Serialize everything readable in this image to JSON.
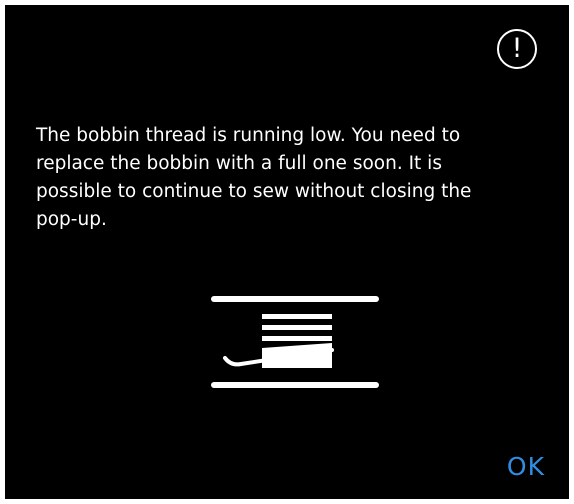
{
  "popup": {
    "alert_icon": {
      "name": "exclamation-circle-icon",
      "glyph": "!"
    },
    "message": "The bobbin thread is running low. You need to\nreplace the bobbin with a full one soon. It is\npossible to continue to sew without closing the\npop-up.",
    "bobbin_icon": "bobbin-low-icon",
    "ok_label": "OK"
  },
  "colors": {
    "background": "#000000",
    "text": "#ffffff",
    "accent": "#2f8ee3"
  }
}
